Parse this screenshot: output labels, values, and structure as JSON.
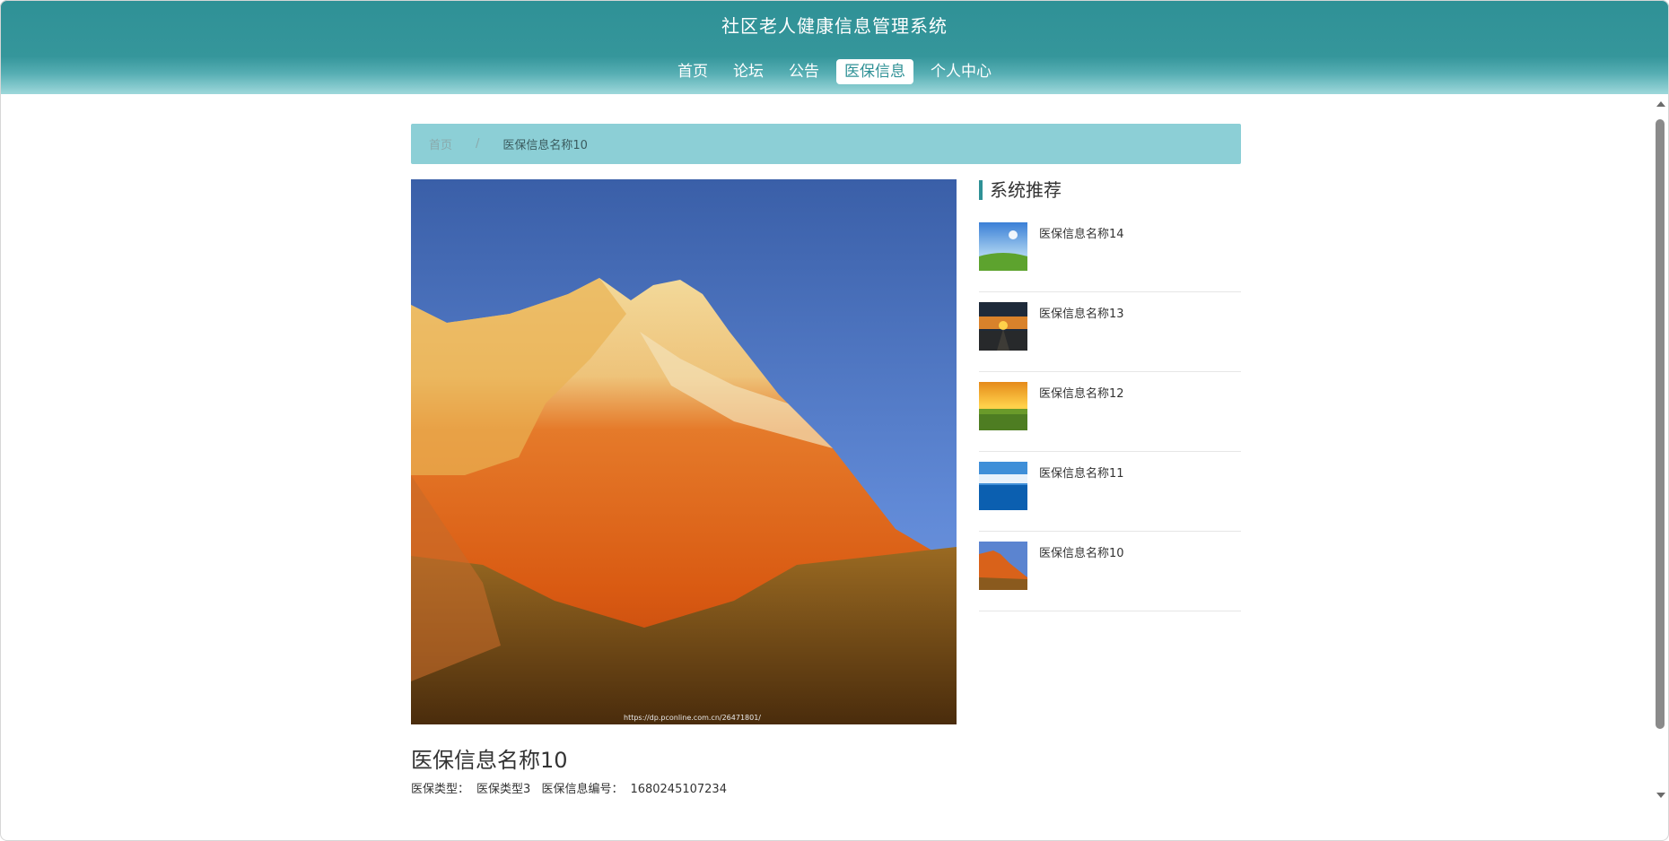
{
  "header": {
    "title": "社区老人健康信息管理系统",
    "nav": [
      {
        "label": "首页"
      },
      {
        "label": "论坛"
      },
      {
        "label": "公告"
      },
      {
        "label": "医保信息",
        "active": true
      },
      {
        "label": "个人中心"
      }
    ]
  },
  "breadcrumb": {
    "home": "首页",
    "separator": "/",
    "current": "医保信息名称10"
  },
  "detail": {
    "image_icon": "painted-mountain-photo",
    "watermark": "https://dp.pconline.com.cn/26471801/",
    "title": "医保信息名称10",
    "type_label": "医保类型：",
    "type_value": "医保类型3",
    "code_label": "医保信息编号：",
    "code_value": "1680245107234"
  },
  "recommend": {
    "title": "系统推荐",
    "items": [
      {
        "label": "医保信息名称14",
        "thumb": "sky-grass-thumbnail"
      },
      {
        "label": "医保信息名称13",
        "thumb": "sunset-road-thumbnail"
      },
      {
        "label": "医保信息名称12",
        "thumb": "sunrise-field-thumbnail"
      },
      {
        "label": "医保信息名称11",
        "thumb": "sea-sky-thumbnail"
      },
      {
        "label": "医保信息名称10",
        "thumb": "painted-mountain-thumbnail"
      }
    ]
  },
  "colors": {
    "header": "#2f9196",
    "breadcrumb_bg": "#8ccfd6",
    "accent": "#2f9196"
  }
}
